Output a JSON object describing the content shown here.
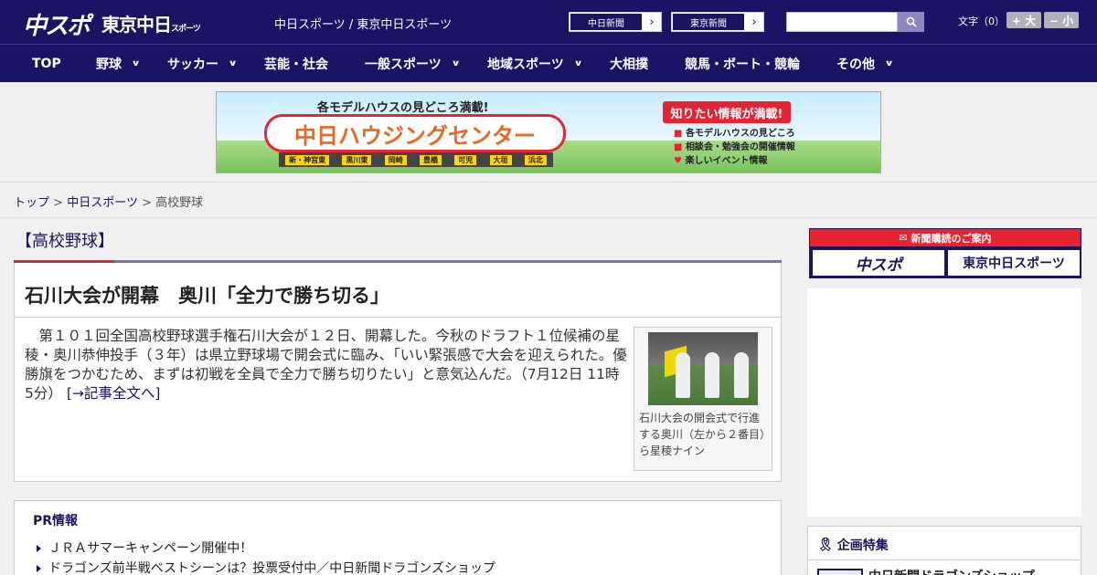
{
  "header": {
    "logo_chuspo": "中スポ",
    "logo_tokyo": "東京中日",
    "logo_tokyo_suffix": "スポーツ",
    "site_names": "中日スポーツ / 東京中日スポーツ",
    "newspaper_buttons": [
      "中日新聞",
      "東京新聞"
    ],
    "search_placeholder": "",
    "font_size_label": "文字（0）",
    "font_larger": "+ 大",
    "font_smaller": "− 小"
  },
  "nav": {
    "items": [
      {
        "label": "TOP",
        "dropdown": false
      },
      {
        "label": "野球",
        "dropdown": true
      },
      {
        "label": "サッカー",
        "dropdown": true
      },
      {
        "label": "芸能・社会",
        "dropdown": false
      },
      {
        "label": "一般スポーツ",
        "dropdown": true
      },
      {
        "label": "地域スポーツ",
        "dropdown": true
      },
      {
        "label": "大相撲",
        "dropdown": false
      },
      {
        "label": "競馬・ボート・競輪",
        "dropdown": false
      },
      {
        "label": "その他",
        "dropdown": true
      }
    ]
  },
  "banner": {
    "top_text": "各モデルハウスの見どころ満載!",
    "main_text": "中日ハウジングセンター",
    "locations": [
      "新・神宮東",
      "黒川東",
      "岡崎",
      "豊橋",
      "可児",
      "大垣",
      "浜北"
    ],
    "right_heading": "知りたい情報が満載!",
    "right_items": [
      "各モデルハウスの見どころ",
      "相談会・勉強会の開催情報",
      "楽しいイベント情報"
    ]
  },
  "breadcrumb": {
    "items": [
      "トップ",
      "中日スポーツ",
      "高校野球"
    ],
    "separator": ">"
  },
  "category": {
    "title": "【高校野球】"
  },
  "article": {
    "headline": "石川大会が開幕　奥川「全力で勝ち切る」",
    "body": "　第１０１回全国高校野球選手権石川大会が１２日、開幕した。今秋のドラフト１位候補の星稜・奥川恭伸投手（３年）は県立野球場で開会式に臨み、「いい緊張感で大会を迎えられた。優勝旗をつかむため、まずは初戦を全員で全力で勝ち切りたい」と意気込んだ。（7月12日 11時5分）",
    "read_more": "[→記事全文へ]",
    "photo_caption": "石川大会の開会式で行進する奥川（左から２番目）ら星稜ナイン"
  },
  "pr": {
    "title": "PR情報",
    "items": [
      "ＪＲＡサマーキャンペーン開催中！",
      "ドラゴンズ前半戦ベストシーンは？投票受付中／中日新聞ドラゴンズショップ"
    ]
  },
  "sidebar": {
    "subscription_heading": "新聞購読のご案内",
    "subscription_buttons": [
      "中スポ",
      "東京中日スポーツ"
    ],
    "feature_title": "企画特集",
    "feature_item": "中日新聞ドラゴンズショップ"
  },
  "colors": {
    "brand_navy": "#1b1464",
    "accent_red": "#e82231"
  }
}
